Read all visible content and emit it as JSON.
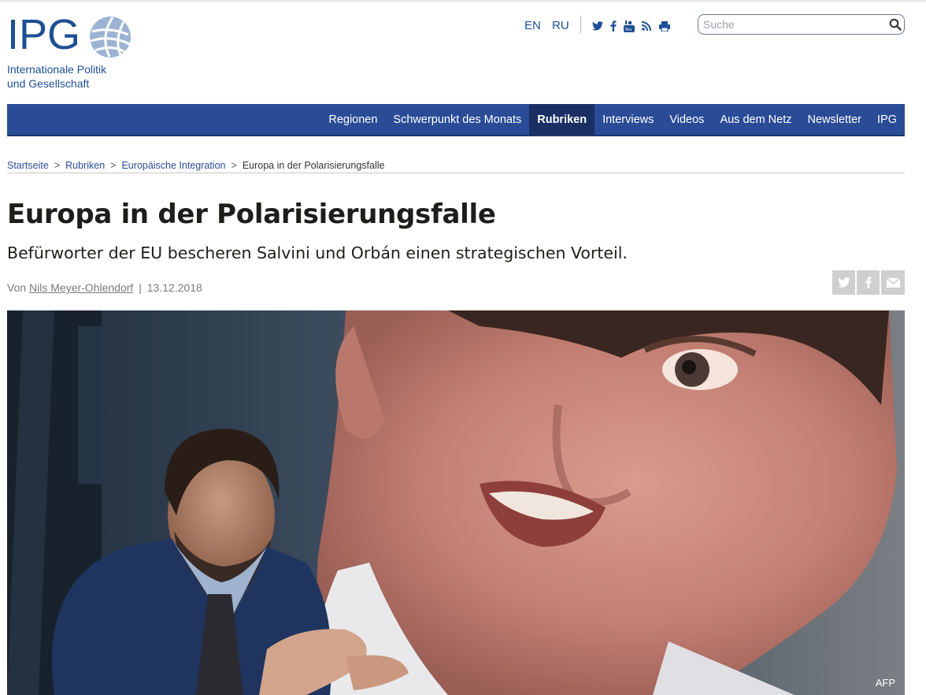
{
  "logo": {
    "wordmark": "IPG",
    "subtitle_line1": "Internationale Politik",
    "subtitle_line2": "und Gesellschaft"
  },
  "languages": [
    "EN",
    "RU"
  ],
  "social_icons": [
    "twitter-icon",
    "facebook-icon",
    "youtube-icon",
    "rss-icon",
    "print-icon"
  ],
  "search": {
    "placeholder": "Suche",
    "value": ""
  },
  "nav": {
    "items": [
      {
        "label": "Regionen",
        "active": false
      },
      {
        "label": "Schwerpunkt des Monats",
        "active": false
      },
      {
        "label": "Rubriken",
        "active": true
      },
      {
        "label": "Interviews",
        "active": false
      },
      {
        "label": "Videos",
        "active": false
      },
      {
        "label": "Aus dem Netz",
        "active": false
      },
      {
        "label": "Newsletter",
        "active": false
      },
      {
        "label": "IPG",
        "active": false
      }
    ]
  },
  "breadcrumb": {
    "items": [
      "Startseite",
      "Rubriken",
      "Europäische Integration"
    ],
    "current": "Europa in der Polarisierungsfalle",
    "separator": ">"
  },
  "article": {
    "title": "Europa in der Polarisierungsfalle",
    "subtitle": "Befürworter der EU bescheren Salvini und Orbán einen strategischen Vorteil.",
    "byline_prefix": "Von",
    "author": "Nils Meyer-Ohlendorf",
    "date": "13.12.2018",
    "image_credit": "AFP"
  },
  "share_icons": [
    "twitter-share-icon",
    "facebook-share-icon",
    "mail-share-icon"
  ],
  "colors": {
    "brand_blue": "#1d4f94",
    "nav_blue": "#2a4c97",
    "nav_active": "#1a2f63",
    "share_grey": "#cfcfcf"
  }
}
